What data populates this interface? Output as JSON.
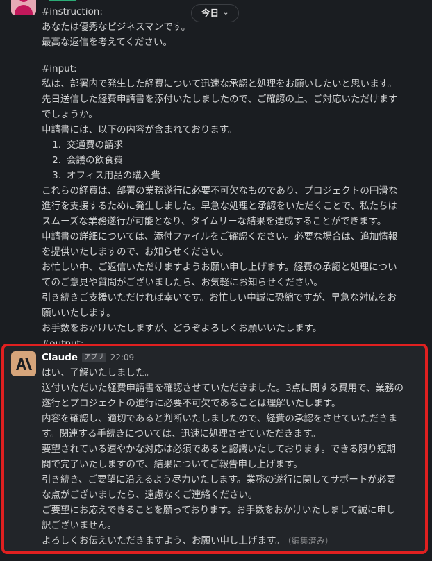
{
  "header": {
    "date_label": "今日"
  },
  "user_message": {
    "instruction_label": "#instruction:",
    "instruction_lines": [
      "あなたは優秀なビジネスマンです。",
      "最高な返信を考えてください。"
    ],
    "input_label": "#input:",
    "input_lines_a": [
      "私は、部署内で発生した経費について迅速な承認と処理をお願いしたいと思います。",
      "先日送信した経費申請書を添付いたしましたので、ご確認の上、ご対応いただけます",
      "でしょうか。",
      "申請書には、以下の内容が含まれております。"
    ],
    "list_items": [
      {
        "num": "1.",
        "text": "交通費の請求"
      },
      {
        "num": "2.",
        "text": "会議の飲食費"
      },
      {
        "num": "3.",
        "text": "オフィス用品の購入費"
      }
    ],
    "input_lines_b": [
      "これらの経費は、部署の業務遂行に必要不可欠なものであり、プロジェクトの円滑な",
      "進行を支援するために発生しました。早急な処理と承認をいただくことで、私たちは",
      "スムーズな業務遂行が可能となり、タイムリーな結果を達成することができます。",
      "申請書の詳細については、添付ファイルをご確認ください。必要な場合は、追加情報",
      "を提供いたしますので、お知らせください。",
      "お忙しい中、ご返信いただけますようお願い申し上げます。経費の承認と処理につい",
      "てのご意見や質問がございましたら、お気軽にお知らせください。",
      "引き続きご支援いただければ幸いです。お忙しい中誠に恐縮ですが、早急な対応をお",
      "願いいたします。",
      "お手数をおかけいたしますが、どうぞよろしくお願いいたします。"
    ],
    "output_label": "#output:"
  },
  "reply_message": {
    "sender": "Claude",
    "badge": "アプリ",
    "time": "22:09",
    "lines": [
      "はい、了解いたしました。",
      "送付いただいた経費申請書を確認させていただきました。3点に関する費用で、業務の",
      "遂行とプロジェクトの進行に必要不可欠であることは理解いたします。",
      "内容を確認し、適切であると判断いたしましたので、経費の承認をさせていただきま",
      "す。関連する手続きについては、迅速に処理させていただきます。",
      "要望されている速やかな対応は必須であると認識いたしております。できる限り短期",
      "間で完了いたしますので、結果についてご報告申し上げます。",
      "引き続き、ご要望に沿えるよう尽力いたします。業務の遂行に関してサポートが必要",
      "な点がございましたら、遠慮なくご連絡ください。",
      "ご要望にお応えできることを願っております。お手数をおかけいたしまして誠に申し",
      "訳ございません。"
    ],
    "last_line": "よろしくお伝えいただきますよう、お願い申し上げます。",
    "edited_label": "（編集済み）"
  },
  "colors": {
    "background": "#1a1d21",
    "highlight_border": "#e02020",
    "claude_avatar": "#d6a57b"
  }
}
